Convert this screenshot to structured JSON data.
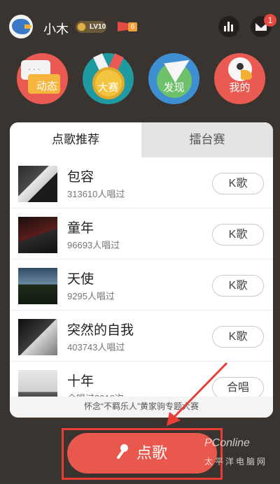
{
  "user": {
    "name": "小木",
    "level_badge": "LV10",
    "flag_count": "6"
  },
  "header": {
    "mail_badge": "1"
  },
  "categories": [
    {
      "label": "动态",
      "icon": "chat-bubble-icon"
    },
    {
      "label": "大赛",
      "icon": "medal-icon"
    },
    {
      "label": "发现",
      "icon": "paper-plane-icon"
    },
    {
      "label": "我的",
      "icon": "parrot-icon"
    }
  ],
  "tabs": [
    {
      "label": "点歌推荐",
      "active": true
    },
    {
      "label": "擂台赛",
      "active": false
    }
  ],
  "songs": [
    {
      "title": "包容",
      "sub": "313610人唱过",
      "button": "K歌"
    },
    {
      "title": "童年",
      "sub": "96693人唱过",
      "button": "K歌"
    },
    {
      "title": "天使",
      "sub": "9295人唱过",
      "button": "K歌"
    },
    {
      "title": "突然的自我",
      "sub": "403743人唱过",
      "button": "K歌"
    },
    {
      "title": "十年",
      "sub": "合唱过2318次",
      "button": "合唱"
    }
  ],
  "footer_note": "怀念“不羁乐人”黄家驹专题大赛",
  "main_button": {
    "label": "点歌"
  },
  "watermark": {
    "brand": "PConline",
    "sub": "太平洋电脑网"
  },
  "colors": {
    "accent": "#e9584d",
    "background": "#3a3431"
  }
}
